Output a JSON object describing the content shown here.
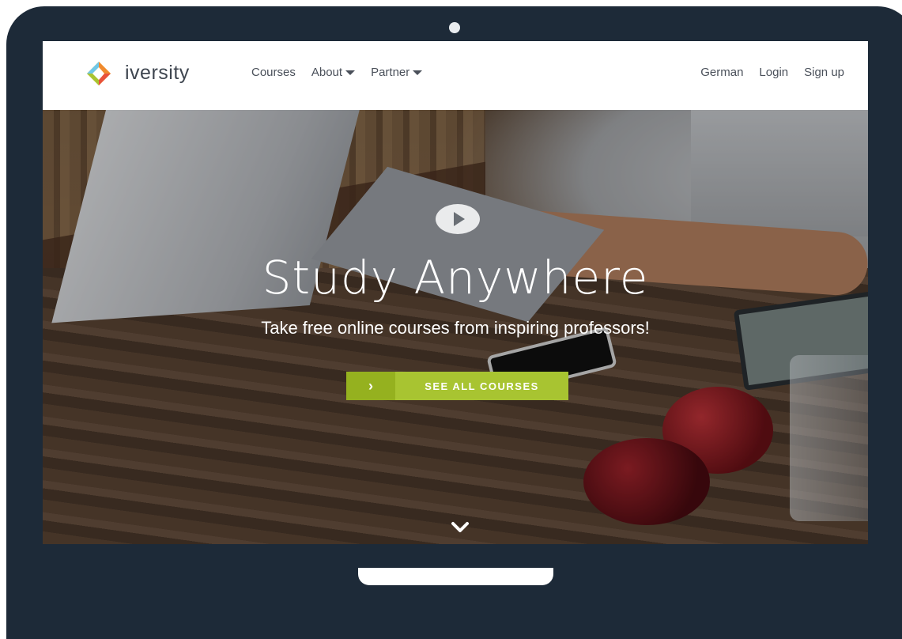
{
  "nav": {
    "brand": "iversity",
    "links": [
      "Courses",
      "About",
      "Partner"
    ],
    "right": [
      "German",
      "Login",
      "Sign up"
    ]
  },
  "hero": {
    "title": "Study Anywhere",
    "subtitle": "Take free online courses from inspiring professors!",
    "cta_label": "SEE ALL COURSES",
    "cta_icon": "chevron-right-icon",
    "play_icon": "play-icon",
    "scroll_icon": "chevron-down-icon"
  },
  "colors": {
    "frame": "#1d2a38",
    "accent": "#a8c431",
    "accent_dark": "#95b11f",
    "nav_text": "#4a505a"
  }
}
